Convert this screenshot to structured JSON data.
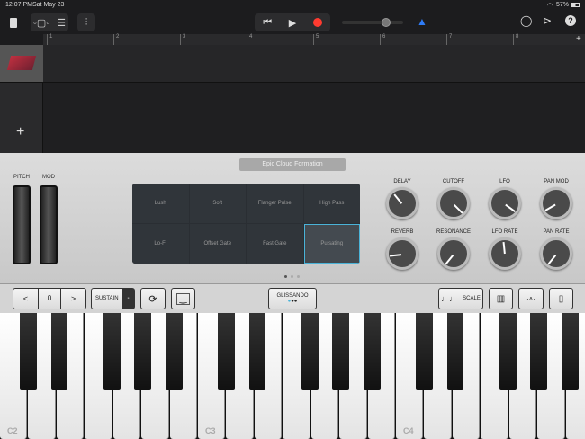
{
  "status": {
    "time": "12:07 PM",
    "date": "Sat May 23",
    "battery": "57%"
  },
  "toolbar": {
    "back_icon": "skip-back-icon",
    "play_icon": "play-icon",
    "record_color": "#ff3b30",
    "metronome_color": "#2f7cf6"
  },
  "ruler": {
    "bars": [
      "1",
      "2",
      "3",
      "4",
      "5",
      "6",
      "7",
      "8"
    ],
    "add": "+"
  },
  "tracks": {
    "add_label": "+"
  },
  "synth": {
    "preset": "Epic Cloud Formation",
    "pitch_label": "PITCH",
    "mod_label": "MOD",
    "pads": [
      "Lush",
      "Soft",
      "Flanger Pulse",
      "High Pass",
      "Lo-Fi",
      "Offset Gate",
      "Fast Gate",
      "Pulsating"
    ],
    "selected_pad": 7,
    "page": {
      "count": 3,
      "current": 0
    },
    "knobs": [
      {
        "label": "DELAY",
        "value": 0.37
      },
      {
        "label": "CUTOFF",
        "value": 0.95
      },
      {
        "label": "LFO",
        "value": 0.92
      },
      {
        "label": "PAN MOD",
        "value": 0.1
      },
      {
        "label": "REVERB",
        "value": 0.18
      },
      {
        "label": "RESONANCE",
        "value": 0.03
      },
      {
        "label": "LFO RATE",
        "value": 0.48
      },
      {
        "label": "PAN RATE",
        "value": 0.03
      }
    ]
  },
  "controls": {
    "prev": "<",
    "octave": "0",
    "next": ">",
    "sustain": "SUSTAIN",
    "glissando": "GLISSANDO",
    "scale": "SCALE",
    "scale_glyph": "♩♩"
  },
  "keyboard": {
    "labels": [
      "C2",
      "C3",
      "C4"
    ]
  }
}
